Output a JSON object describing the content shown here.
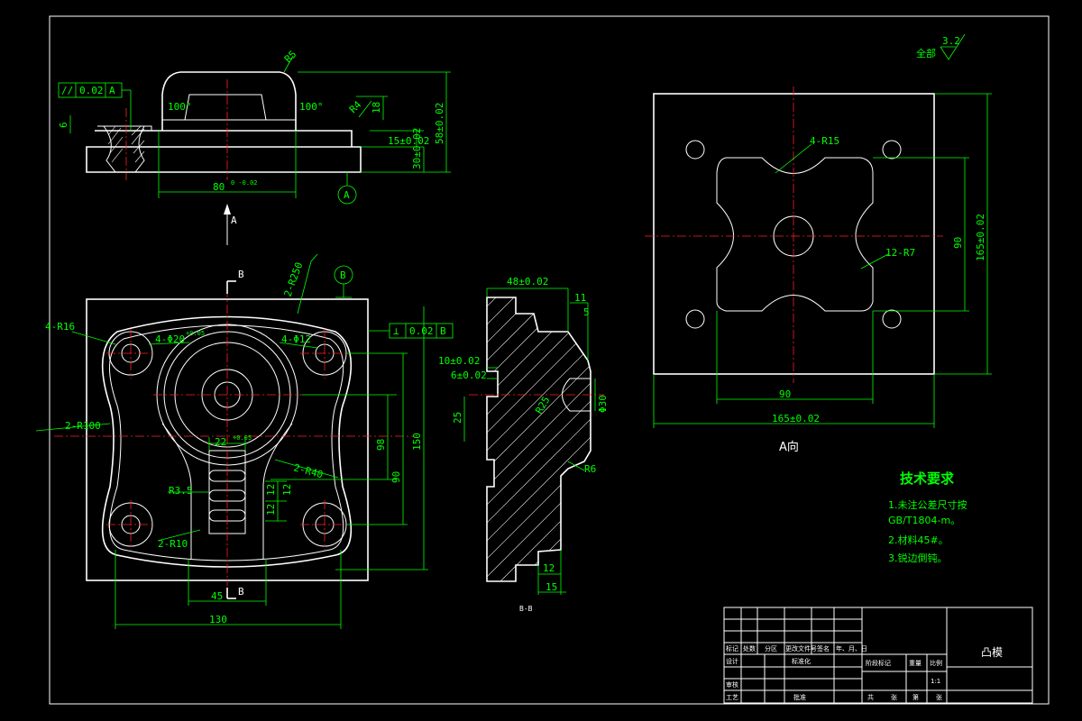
{
  "top_view": {
    "flatness_label": "//",
    "flatness_value": "0.02",
    "flatness_datum": "A",
    "dim_r5": "R5",
    "dim_r4": "R4",
    "dim_angle_left": "100°",
    "dim_angle_right": "100°",
    "dim_6": "6",
    "dim_18": "18",
    "dim_15": "15±0.02",
    "dim_30": "30±0.02",
    "dim_58": "58±0.02",
    "dim_80": "80",
    "dim_80_tol": "0\n-0.02",
    "datum_a": "A",
    "view_arrow": "A"
  },
  "front_view": {
    "section_label_top": "B",
    "section_label_bottom": "B",
    "datum_b": "B",
    "perp_symbol": "⊥",
    "perp_value": "0.02",
    "perp_datum": "B",
    "dim_4r16": "4-R16",
    "dim_4phi20": "4-Φ20",
    "dim_4phi20_tol": "+0.05",
    "dim_4phi12": "4-Φ12",
    "dim_2r100": "2-R100",
    "dim_2r250": "2-R250",
    "dim_2r40": "2-R40",
    "dim_2r10": "2-R10",
    "dim_r3_5": "R3.5",
    "dim_22": "22",
    "dim_22_tol": "+0.05",
    "dim_12a": "12",
    "dim_12b": "12",
    "dim_12c": "12",
    "dim_98": "98",
    "dim_90": "90",
    "dim_150": "150",
    "dim_45": "45",
    "dim_130": "130"
  },
  "section_view": {
    "dim_48": "48±0.02",
    "dim_11": "11",
    "dim_5": "5",
    "dim_10": "10±0.02",
    "dim_6": "6±0.02",
    "dim_25": "25",
    "dim_r6": "R6",
    "dim_12": "12",
    "dim_15": "15",
    "dim_phi30": "Φ30",
    "dim_r25": "R25",
    "section_name": "B-B"
  },
  "a_view": {
    "dim_4r15": "4-R15",
    "dim_12r7": "12-R7",
    "dim_90v": "90",
    "dim_90h": "90",
    "dim_165v": "165±0.02",
    "dim_165h": "165±0.02",
    "view_name": "A向"
  },
  "roughness": {
    "label": "全部",
    "value": "3.2"
  },
  "notes": {
    "title": "技术要求",
    "line1": "1.未注公差尺寸按",
    "line2": "GB/T1804-m。",
    "line3": "2.材料45#。",
    "line4": "3.锐边倒钝。"
  },
  "title_block": {
    "part_name": "凸模",
    "scale_label": "比例",
    "scale_value": "1:1",
    "stage_label": "阶段标记",
    "weight_label": "重量",
    "sheet_total": "共",
    "sheet_of": "张",
    "sheet_no": "第",
    "sheet_unit": "张",
    "row_mark": "标记",
    "row_count": "处数",
    "row_zone": "分区",
    "row_docno": "更改文件号",
    "row_sign": "签名",
    "row_date": "年、月、日",
    "design": "设计",
    "standard": "标准化",
    "review": "审核",
    "process": "工艺",
    "approve": "批准"
  },
  "colors": {
    "outline": "#ffffff",
    "dimension": "#00ff00",
    "centerline": "#ff2020",
    "background": "#000000"
  }
}
